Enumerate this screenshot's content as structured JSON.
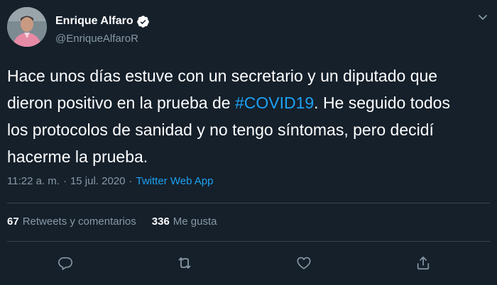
{
  "user": {
    "display_name": "Enrique Alfaro",
    "handle": "@EnriqueAlfaroR",
    "verified": true
  },
  "tweet": {
    "text_parts": [
      "Hace unos días estuve con un secretario y un diputado que dieron positivo en la prueba de ",
      "#COVID19",
      ". He seguido todos los protocolos de sanidad y no tengo síntomas, pero decidí hacerme la prueba."
    ],
    "time": "11:22 a. m.",
    "date": "15 jul. 2020",
    "separator": "·",
    "source": "Twitter Web App"
  },
  "stats": {
    "retweets_count": "67",
    "retweets_label": "Retweets y comentarios",
    "likes_count": "336",
    "likes_label": "Me gusta"
  },
  "icons": {
    "caret": "chevron-down-icon",
    "verified": "verified-badge-icon",
    "reply": "reply-icon",
    "retweet": "retweet-icon",
    "like": "heart-icon",
    "share": "share-icon"
  },
  "colors": {
    "background": "#15202b",
    "text": "#ffffff",
    "secondary": "#8899a6",
    "accent": "#1da1f2",
    "divider": "#38444d"
  }
}
